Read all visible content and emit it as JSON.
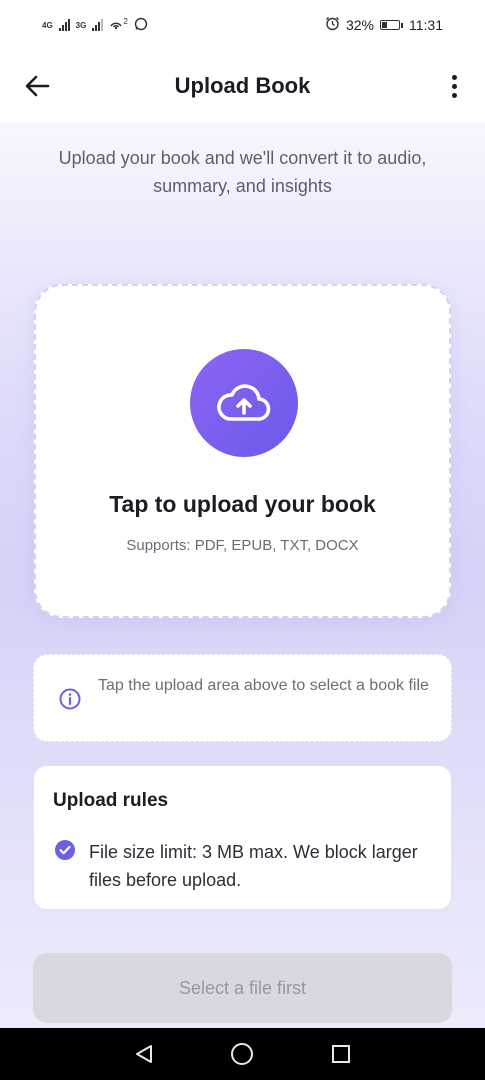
{
  "status_bar": {
    "network_1": "4G",
    "network_2": "3G",
    "hotspot_count": "2",
    "battery_percent": "32%",
    "battery_level": 0.32,
    "time": "11:31",
    "icons": [
      "signal-icon",
      "hotspot-icon",
      "whatsapp-icon",
      "alarm-icon",
      "battery-icon"
    ]
  },
  "app_bar": {
    "title": "Upload Book",
    "back_icon": "arrow-left-icon",
    "menu_icon": "more-vertical-icon"
  },
  "main": {
    "subtitle": "Upload your book and we'll convert it to audio, summary, and insights",
    "upload_card": {
      "icon": "cloud-upload-icon",
      "title": "Tap to upload your book",
      "supported": "Supports: PDF, EPUB, TXT, DOCX"
    },
    "info": {
      "icon": "info-icon",
      "text": "Tap the upload area above to select a book file"
    },
    "rules": {
      "title": "Upload rules",
      "items": [
        {
          "icon": "check-circle-icon",
          "text": "File size limit: 3 MB max. We block larger files before upload."
        }
      ]
    },
    "primary_button": {
      "label": "Select a file first",
      "enabled": false
    }
  },
  "colors": {
    "accent": "#7b5cf0",
    "accent_gradient_start": "#8e63f3",
    "accent_gradient_end": "#6a5bea",
    "disabled_button_bg": "#d8d8e0",
    "disabled_button_text": "#9797a2"
  },
  "nav_bar": {
    "buttons": [
      "back-triangle-icon",
      "home-circle-icon",
      "recents-square-icon"
    ]
  }
}
